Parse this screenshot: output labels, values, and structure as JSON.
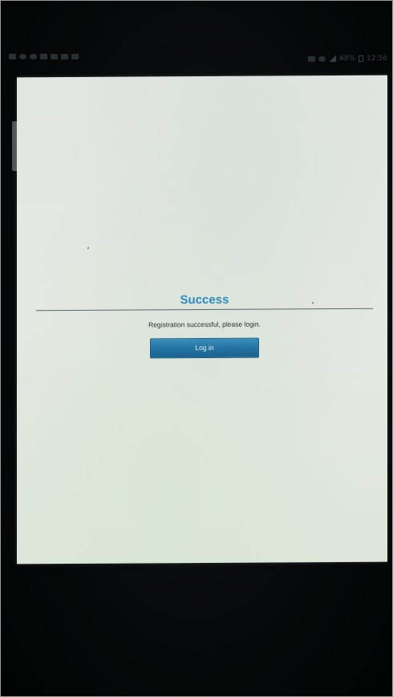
{
  "status_bar": {
    "battery_text": "48%",
    "time_text": "12:56"
  },
  "dialog": {
    "title": "Success",
    "message": "Registration successful, please login.",
    "login_button_label": "Log in"
  },
  "colors": {
    "title_color": "#2e8cbf",
    "button_color": "#2473a2",
    "screen_background": "#e3e6e1"
  },
  "icons": {
    "status_left": [
      "back-icon",
      "notification-icon",
      "cloud-icon",
      "mail-icon",
      "mail-icon",
      "mail-icon",
      "play-icon"
    ],
    "status_right": [
      "nfc-icon",
      "wifi-icon",
      "signal-icon",
      "battery-icon"
    ]
  }
}
